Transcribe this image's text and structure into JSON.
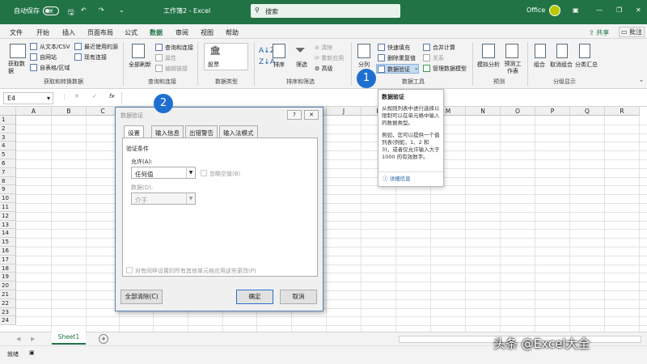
{
  "titlebar": {
    "autosave": "自动保存",
    "toggle_state": "关",
    "title": "工作簿2 - Excel",
    "search_placeholder": "搜索",
    "account": "Office",
    "colors": {
      "bg": "#217346"
    }
  },
  "menubar": {
    "items": [
      "文件",
      "开始",
      "插入",
      "页面布局",
      "公式",
      "数据",
      "审阅",
      "视图",
      "帮助"
    ],
    "active": "数据",
    "share": "共享",
    "comment": "批注"
  },
  "ribbon": {
    "get_data": {
      "big_label": "获取数据",
      "items": [
        "从文本/CSV",
        "自网站",
        "自表格/区域",
        "最近使用的源",
        "现有连接"
      ],
      "group": "获取和转换数据"
    },
    "queries": {
      "big_label": "全部刷新",
      "items": [
        "查询和连接",
        "属性",
        "编辑链接"
      ],
      "group": "查询和连接"
    },
    "types": {
      "label": "股票",
      "group": "数据类型"
    },
    "sort": {
      "sort_label": "排序",
      "filter_label": "筛选",
      "items": [
        "清除",
        "重新应用",
        "高级"
      ],
      "group": "排序和筛选"
    },
    "tools": {
      "big_label": "分列",
      "items": [
        "快速填充",
        "删除重复值",
        "数据验证",
        "合并计算",
        "关系",
        "管理数据模型"
      ],
      "group": "数据工具"
    },
    "forecast": {
      "items": [
        "模拟分析",
        "预测工作表"
      ],
      "group": "预测"
    },
    "outline": {
      "items": [
        "组合",
        "取消组合",
        "分类汇总"
      ],
      "group": "分级显示"
    }
  },
  "formulabar": {
    "cell_ref": "E4",
    "fx": "fx"
  },
  "grid": {
    "columns": [
      "A",
      "B",
      "C",
      "D",
      "E",
      "F",
      "G",
      "H",
      "I",
      "J",
      "K",
      "L",
      "M",
      "N",
      "O",
      "P",
      "Q",
      "R"
    ],
    "rows": [
      "1",
      "2",
      "3",
      "4",
      "5",
      "6",
      "7",
      "8",
      "9",
      "10",
      "11",
      "12",
      "13",
      "14",
      "15",
      "16",
      "17",
      "18",
      "19",
      "20",
      "21",
      "22",
      "23",
      "24"
    ]
  },
  "dialog": {
    "title": "数据验证",
    "tabs": [
      "设置",
      "输入信息",
      "出错警告",
      "输入法模式"
    ],
    "section": "验证条件",
    "allow_label": "允许(A):",
    "allow_value": "任何值",
    "ignore_blank": "忽略空值(B)",
    "data_label": "数据(D):",
    "data_value": "介于",
    "apply_all": "对有同样设置的所有其他单元格应用这些更改(P)",
    "clear_all": "全部清除(C)",
    "ok": "确定",
    "cancel": "取消"
  },
  "tooltip": {
    "title": "数据验证",
    "body1": "从规则列表中进行选择以限制可以在单元格中输入的数据类型。",
    "body2": "例如，您可以提供一个值列表(例如，1、2 和 3)，或者仅允许输入大于 1000 的有效数字。",
    "more": "详细信息"
  },
  "badges": [
    "1",
    "2"
  ],
  "sheetbar": {
    "tab": "Sheet1"
  },
  "statusbar": {
    "mode": "就绪"
  },
  "watermark": "头条 @Excel大全"
}
